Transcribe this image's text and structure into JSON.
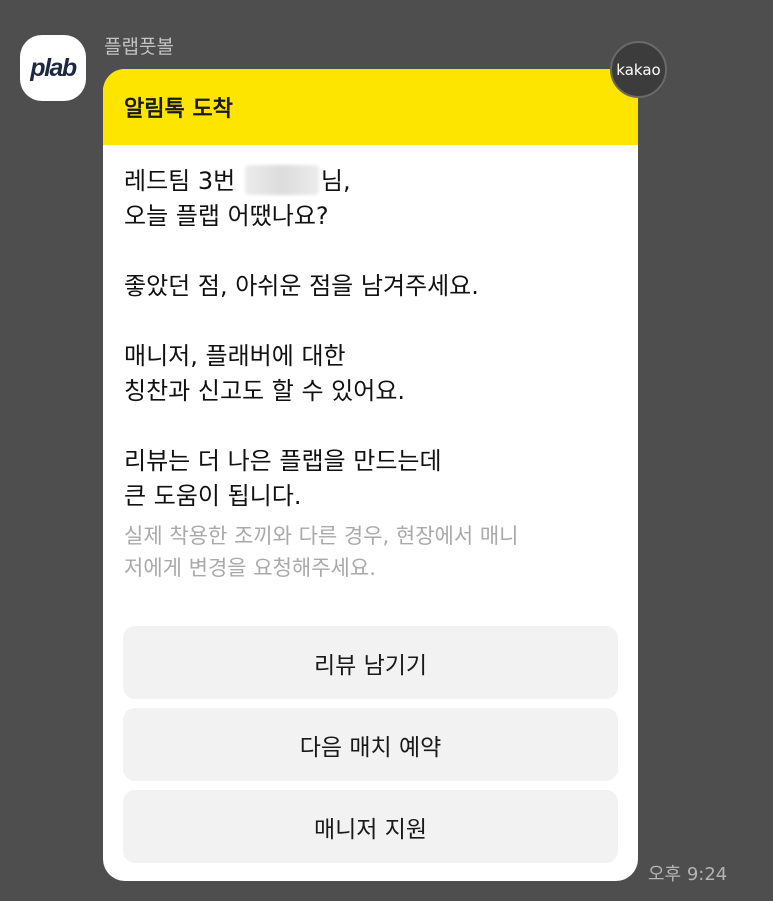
{
  "sender": {
    "name": "플랩풋볼",
    "avatar_text": "plab"
  },
  "badge": {
    "label": "kakao"
  },
  "message": {
    "header_title": "알림톡 도착",
    "line1_prefix": "레드팀 3번",
    "line1_suffix": "님,",
    "line2": "오늘 플랩 어땠나요?",
    "line3": "좋았던 점, 아쉬운 점을 남겨주세요.",
    "line4": "매니저, 플래버에 대한",
    "line5": "칭찬과 신고도 할 수 있어요.",
    "line6": "리뷰는 더 나은 플랩을 만드는데",
    "line7": "큰 도움이 됩니다.",
    "notice_line1": "실제 착용한 조끼와 다른 경우, 현장에서 매니",
    "notice_line2": "저에게 변경을 요청해주세요."
  },
  "buttons": [
    {
      "label": "리뷰 남기기"
    },
    {
      "label": "다음 매치 예약"
    },
    {
      "label": "매니저 지원"
    }
  ],
  "timestamp": "오후 9:24",
  "colors": {
    "background": "#4e4e4e",
    "header": "#fee500",
    "button": "#f2f2f2"
  }
}
